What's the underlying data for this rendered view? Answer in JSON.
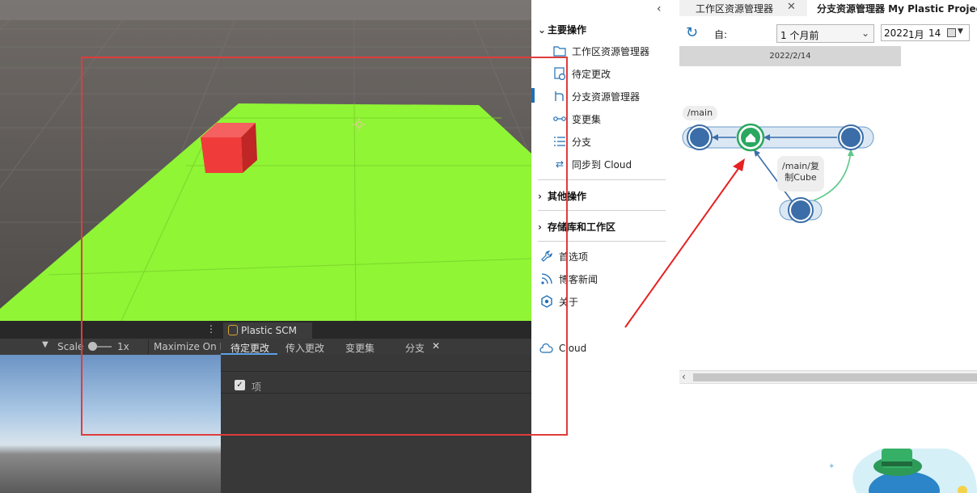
{
  "unity": {
    "toolbar": {
      "scale_label": "Scale",
      "scale_value": "1x",
      "maximize_label": "Maximize On P"
    },
    "plastic_tab_label": "Plastic SCM",
    "tabs": [
      {
        "label": "待定更改"
      },
      {
        "label": "传入更改"
      },
      {
        "label": "变更集"
      },
      {
        "label": "分支"
      }
    ],
    "list_header": "项"
  },
  "plastic": {
    "sidebar": {
      "main_ops_label": "主要操作",
      "items": [
        {
          "label": "工作区资源管理器",
          "icon": "folder-icon"
        },
        {
          "label": "待定更改",
          "icon": "pending-changes-icon"
        },
        {
          "label": "分支资源管理器",
          "icon": "branch-explorer-icon"
        },
        {
          "label": "变更集",
          "icon": "changeset-icon"
        },
        {
          "label": "分支",
          "icon": "branches-list-icon"
        },
        {
          "label": "同步到 Cloud",
          "icon": "sync-icon"
        }
      ],
      "other_ops_label": "其他操作",
      "repos_label": "存储库和工作区",
      "bottom_items": [
        {
          "label": "首选项",
          "icon": "wrench-icon"
        },
        {
          "label": "博客新闻",
          "icon": "rss-icon"
        },
        {
          "label": "关于",
          "icon": "plastic-logo-icon"
        }
      ],
      "cloud_label": "Cloud"
    },
    "tabs": [
      {
        "label": "工作区资源管理器"
      },
      {
        "label": "分支资源管理器 My Plastic Projec"
      }
    ],
    "filter": {
      "from_label": "自:",
      "range_value": "1 个月前",
      "date_year": "2022",
      "date_month": "1月",
      "date_day": "14"
    },
    "graph": {
      "date_header": "2022/2/14",
      "main_branch_label": "/main",
      "child_branch_label_line1": "/main/复",
      "child_branch_label_line2": "制Cube"
    }
  },
  "colors": {
    "ground": "#8ff535",
    "cube": "#f03b3b",
    "highlight_box": "#e03c3c",
    "accent": "#1f6fb5",
    "node_blue": "#3b6ea8",
    "node_green": "#2aa860",
    "arrow_red": "#e52222"
  }
}
